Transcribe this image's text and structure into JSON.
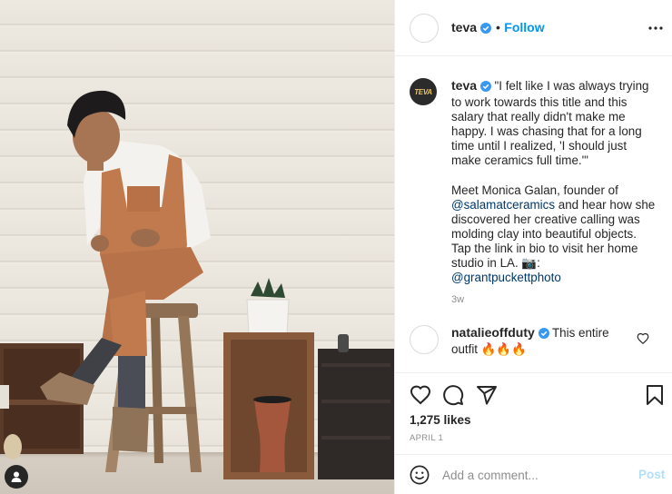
{
  "header": {
    "username": "teva",
    "separator": "•",
    "follow_label": "Follow"
  },
  "caption": {
    "username": "teva",
    "logo_text": "TEVA",
    "para1_lines": [
      "\"I felt like I was always trying",
      "to work towards this title and this",
      "salary that really didn't make me",
      "happy. I was chasing that for a long",
      "time until I realized, 'I should just",
      "make ceramics full time.'\""
    ],
    "para2_line1": "Meet Monica Galan, founder of",
    "mention1": "@salamatceramics",
    "para2_line2_rest": " and hear how she",
    "para2_lines": [
      "discovered her creative calling was",
      "molding clay into beautiful objects.",
      "Tap the link in bio to visit her home",
      "studio in LA. 📷:"
    ],
    "mention2": "@grantpuckettphoto",
    "time": "3w"
  },
  "comment": {
    "username": "natalieoffduty",
    "text": "This entire",
    "text2": "outfit 🔥🔥🔥"
  },
  "actions": {
    "likes": "1,275 likes",
    "date": "APRIL 1"
  },
  "add_comment": {
    "placeholder": "Add a comment...",
    "post_label": "Post"
  },
  "colors": {
    "accent": "#0095f6",
    "mention": "#00376b",
    "muted": "#8e8e8e"
  },
  "icons": [
    "verified-icon",
    "more-options-icon",
    "heart-icon",
    "comment-icon",
    "share-icon",
    "bookmark-icon",
    "emoji-icon",
    "user-tag-icon"
  ]
}
